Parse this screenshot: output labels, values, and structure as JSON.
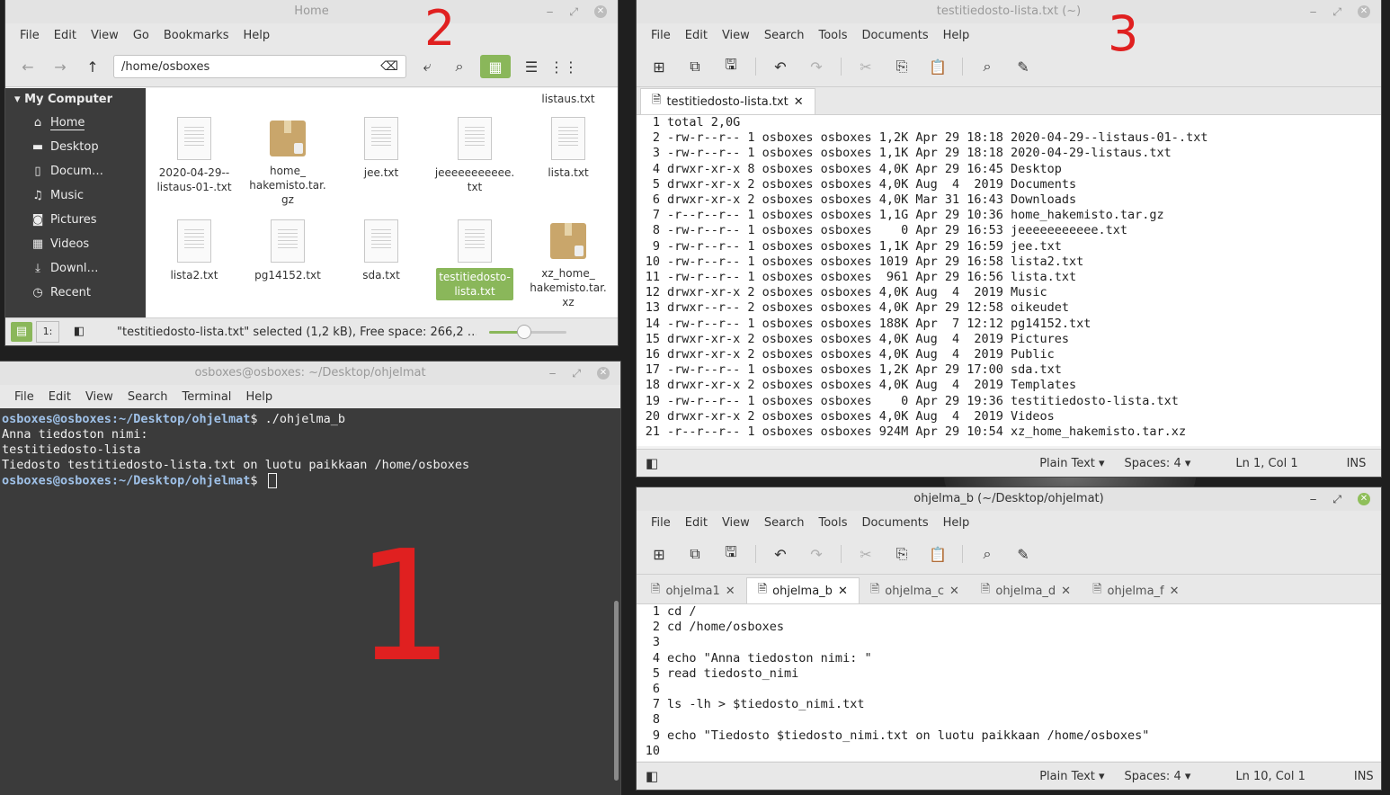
{
  "file_manager": {
    "title": "Home",
    "menu": [
      "File",
      "Edit",
      "View",
      "Go",
      "Bookmarks",
      "Help"
    ],
    "path": "/home/osboxes",
    "sidebar": {
      "header": "My Computer",
      "items": [
        "Home",
        "Desktop",
        "Docum…",
        "Music",
        "Pictures",
        "Videos",
        "Downl…",
        "Recent"
      ]
    },
    "partial_top_label": "listaus.txt",
    "files": [
      {
        "name": "2020-04-29--\nlistaus-01-.txt",
        "type": "doc"
      },
      {
        "name": "home_\nhakemisto.tar.\ngz",
        "type": "pkg"
      },
      {
        "name": "jee.txt",
        "type": "doc"
      },
      {
        "name": "jeeeeeeeeeee.\ntxt",
        "type": "doc"
      },
      {
        "name": "lista.txt",
        "type": "doc"
      },
      {
        "name": "lista2.txt",
        "type": "doc"
      },
      {
        "name": "pg14152.txt",
        "type": "doc"
      },
      {
        "name": "sda.txt",
        "type": "doc"
      },
      {
        "name": "testitiedosto-\nlista.txt",
        "type": "doc",
        "selected": true
      },
      {
        "name": "xz_home_\nhakemisto.tar.\nxz",
        "type": "pkg"
      }
    ],
    "status": "\"testitiedosto-lista.txt\" selected (1,2 kB), Free space: 266,2 …",
    "zoom_fraction": 0.45,
    "accent": "#8ab75a"
  },
  "terminal": {
    "title": "osboxes@osboxes: ~/Desktop/ohjelmat",
    "menu": [
      "File",
      "Edit",
      "View",
      "Search",
      "Terminal",
      "Help"
    ],
    "lines": [
      {
        "prompt": "osboxes@osboxes:~/Desktop/ohjelmat",
        "suffix": "$",
        "text": " ./ohjelma_b"
      },
      {
        "text": "Anna tiedoston nimi:"
      },
      {
        "text": "testitiedosto-lista"
      },
      {
        "text": "Tiedosto testitiedosto-lista.txt on luotu paikkaan /home/osboxes"
      },
      {
        "prompt": "osboxes@osboxes:~/Desktop/ohjelmat",
        "suffix": "$",
        "text": " ",
        "cursor": true
      }
    ]
  },
  "editor_top": {
    "title": "testitiedosto-lista.txt (~)",
    "menu": [
      "File",
      "Edit",
      "View",
      "Search",
      "Tools",
      "Documents",
      "Help"
    ],
    "tab": "testitiedosto-lista.txt",
    "lines": [
      "total 2,0G",
      "-rw-r--r-- 1 osboxes osboxes 1,2K Apr 29 18:18 2020-04-29--listaus-01-.txt",
      "-rw-r--r-- 1 osboxes osboxes 1,1K Apr 29 18:18 2020-04-29-listaus.txt",
      "drwxr-xr-x 8 osboxes osboxes 4,0K Apr 29 16:45 Desktop",
      "drwxr-xr-x 2 osboxes osboxes 4,0K Aug  4  2019 Documents",
      "drwxr-xr-x 2 osboxes osboxes 4,0K Mar 31 16:43 Downloads",
      "-r--r--r-- 1 osboxes osboxes 1,1G Apr 29 10:36 home_hakemisto.tar.gz",
      "-rw-r--r-- 1 osboxes osboxes    0 Apr 29 16:53 jeeeeeeeeeee.txt",
      "-rw-r--r-- 1 osboxes osboxes 1,1K Apr 29 16:59 jee.txt",
      "-rw-r--r-- 1 osboxes osboxes 1019 Apr 29 16:58 lista2.txt",
      "-rw-r--r-- 1 osboxes osboxes  961 Apr 29 16:56 lista.txt",
      "drwxr-xr-x 2 osboxes osboxes 4,0K Aug  4  2019 Music",
      "drwxr--r-- 2 osboxes osboxes 4,0K Apr 29 12:58 oikeudet",
      "-rw-r--r-- 1 osboxes osboxes 188K Apr  7 12:12 pg14152.txt",
      "drwxr-xr-x 2 osboxes osboxes 4,0K Aug  4  2019 Pictures",
      "drwxr-xr-x 2 osboxes osboxes 4,0K Aug  4  2019 Public",
      "-rw-r--r-- 1 osboxes osboxes 1,2K Apr 29 17:00 sda.txt",
      "drwxr-xr-x 2 osboxes osboxes 4,0K Aug  4  2019 Templates",
      "-rw-r--r-- 1 osboxes osboxes    0 Apr 29 19:36 testitiedosto-lista.txt",
      "drwxr-xr-x 2 osboxes osboxes 4,0K Aug  4  2019 Videos",
      "-r--r--r-- 1 osboxes osboxes 924M Apr 29 10:54 xz_home_hakemisto.tar.xz"
    ],
    "status": {
      "lang": "Plain Text",
      "spaces": "Spaces: 4",
      "pos": "Ln 1, Col 1",
      "mode": "INS"
    }
  },
  "editor_bottom": {
    "title": "ohjelma_b (~/Desktop/ohjelmat)",
    "menu": [
      "File",
      "Edit",
      "View",
      "Search",
      "Tools",
      "Documents",
      "Help"
    ],
    "tabs": [
      "ohjelma1",
      "ohjelma_b",
      "ohjelma_c",
      "ohjelma_d",
      "ohjelma_f"
    ],
    "active_tab": "ohjelma_b",
    "lines": [
      "cd /",
      "cd /home/osboxes",
      "",
      "echo \"Anna tiedoston nimi: \"",
      "read tiedosto_nimi",
      "",
      "ls -lh > $tiedosto_nimi.txt",
      "",
      "echo \"Tiedosto $tiedosto_nimi.txt on luotu paikkaan /home/osboxes\"",
      ""
    ],
    "status": {
      "lang": "Plain Text",
      "spaces": "Spaces: 4",
      "pos": "Ln 10, Col 1",
      "mode": "INS"
    }
  },
  "annotations": [
    "1",
    "2",
    "3"
  ],
  "colors": {
    "annotation": "#e02020",
    "prompt": "#9fc1e8",
    "terminal_bg": "#3b3b3b"
  }
}
